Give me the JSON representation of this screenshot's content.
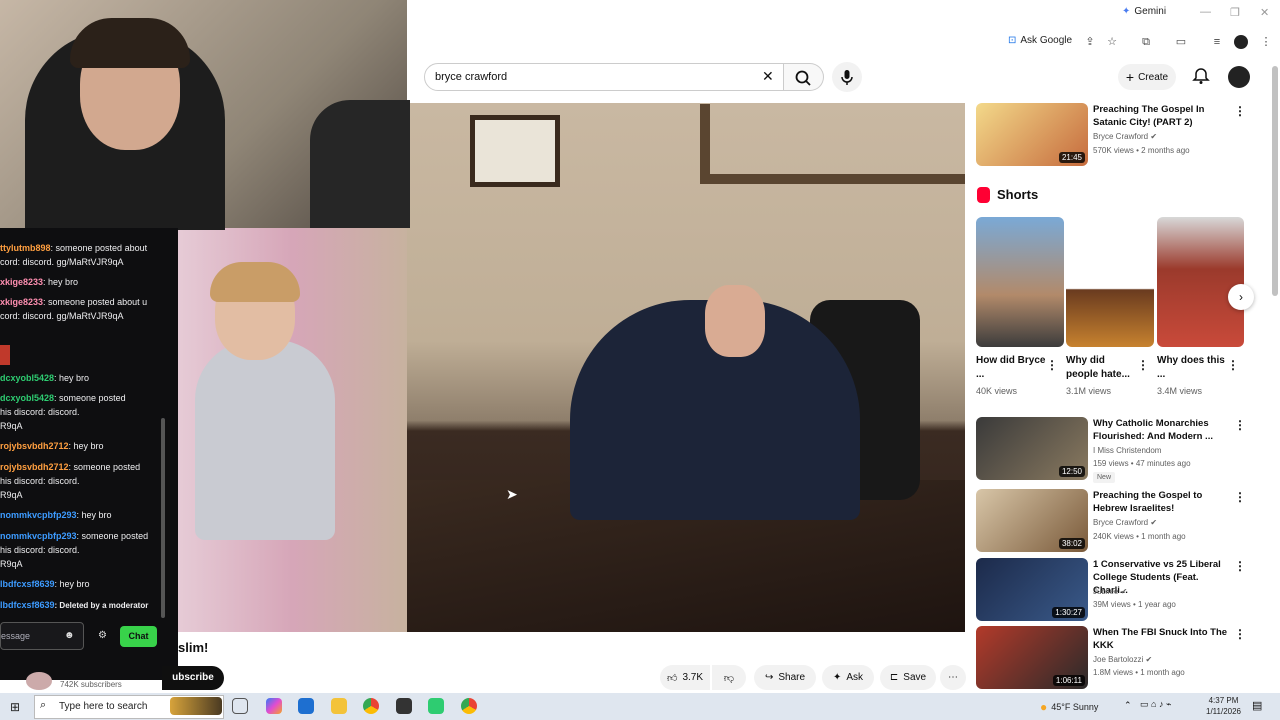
{
  "browser": {
    "gemini_label": "Gemini",
    "ask_google_label": "Ask Google"
  },
  "header": {
    "search_value": "bryce crawford",
    "create_label": "Create"
  },
  "chat": {
    "messages": [
      {
        "user": "ttylutmb898",
        "text": ": someone posted about",
        "color": "#ff9f40"
      },
      {
        "user": "",
        "text": "cord: discord. gg/MaRtVJR9qA",
        "color": "#efeff1"
      },
      {
        "user": "xkige8233",
        "text": ": hey bro",
        "color": "#ff8fb1"
      },
      {
        "user": "xkige8233",
        "text": ": someone posted about u",
        "color": "#ff8fb1"
      },
      {
        "user": "",
        "text": "cord: discord. gg/MaRtVJR9qA",
        "color": "#efeff1"
      },
      {
        "user": "dcxyobl5428",
        "text": ": hey bro",
        "color": "#2ecc71"
      },
      {
        "user": "dcxyobl5428",
        "text": ": someone posted",
        "color": "#2ecc71"
      },
      {
        "user": "",
        "text": "his discord: discord.",
        "color": "#efeff1"
      },
      {
        "user": "",
        "text": "R9qA",
        "color": "#efeff1"
      },
      {
        "user": "rojybsvbdh2712",
        "text": ": hey bro",
        "color": "#ff9f40"
      },
      {
        "user": "rojybsvbdh2712",
        "text": ": someone posted",
        "color": "#ff9f40"
      },
      {
        "user": "",
        "text": "his discord: discord.",
        "color": "#efeff1"
      },
      {
        "user": "",
        "text": "R9qA",
        "color": "#efeff1"
      },
      {
        "user": "nommkvcpbfp293",
        "text": ": hey bro",
        "color": "#3d9bff"
      },
      {
        "user": "nommkvcpbfp293",
        "text": ": someone posted",
        "color": "#3d9bff"
      },
      {
        "user": "",
        "text": "his discord: discord.",
        "color": "#efeff1"
      },
      {
        "user": "",
        "text": "R9qA",
        "color": "#efeff1"
      },
      {
        "user": "lbdfcxsf8639",
        "text": ": hey bro",
        "color": "#3d9bff"
      },
      {
        "user": "lbdfcxsf8639",
        "text": ": Deleted by a moderator",
        "color": "#3d9bff"
      }
    ],
    "input_placeholder": "essage",
    "chat_button": "Chat"
  },
  "video": {
    "title_partial": "slim!",
    "subscribe_label": "ubscribe",
    "subscribers": "742K subscribers",
    "likes": "3.7K",
    "share_label": "Share",
    "ask_label": "Ask",
    "save_label": "Save"
  },
  "sidebar": {
    "recs_top": [
      {
        "title": "Preaching The Gospel In Satanic City! (PART 2)",
        "channel": "Bryce Crawford",
        "meta": "570K views • 2 months ago",
        "duration": "21:45",
        "verified": true
      }
    ],
    "shorts_heading": "Shorts",
    "shorts": [
      {
        "title": "How did Bryce ...",
        "views": "40K views"
      },
      {
        "title": "Why did people hate...",
        "views": "3.1M views"
      },
      {
        "title": "Why does this ...",
        "views": "3.4M views"
      }
    ],
    "recs": [
      {
        "title": "Why Catholic Monarchies Flourished: And Modern ...",
        "channel": "I Miss Christendom",
        "meta": "159 views • 47 minutes ago",
        "duration": "12:50",
        "badge": "New",
        "verified": false
      },
      {
        "title": "Preaching the Gospel to Hebrew Israelites!",
        "channel": "Bryce Crawford",
        "meta": "240K views • 1 month ago",
        "duration": "38:02",
        "verified": true
      },
      {
        "title": "1 Conservative vs 25 Liberal College Students (Feat. Charli...",
        "channel": "Jubilee",
        "meta": "39M views • 1 year ago",
        "duration": "1:30:27",
        "verified": true
      },
      {
        "title": "When The FBI Snuck Into The KKK",
        "channel": "Joe Bartolozzi",
        "meta": "1.8M views • 1 month ago",
        "duration": "1:06:11",
        "verified": true
      }
    ]
  },
  "taskbar": {
    "search_placeholder": "Type here to search",
    "weather": "45°F  Sunny",
    "time": "4:37 PM",
    "date": "1/11/2026"
  },
  "colors": {
    "chat_bg": "#0e0e10",
    "chat_button": "#38d24a",
    "youtube_red": "#ff0033"
  }
}
